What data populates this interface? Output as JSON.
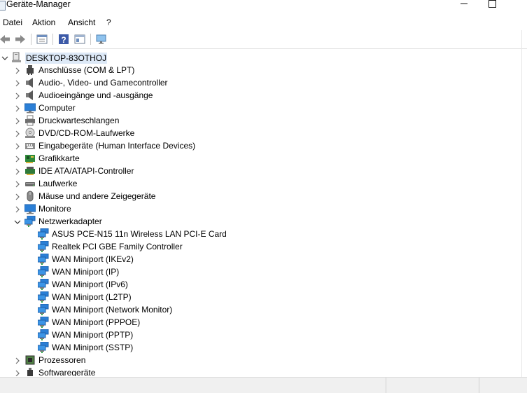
{
  "window": {
    "title": "Geräte-Manager"
  },
  "menu": [
    "Datei",
    "Aktion",
    "Ansicht",
    "?"
  ],
  "toolbar": {
    "buttons": [
      "back-icon",
      "forward-icon",
      "properties-icon",
      "help-icon",
      "view-icon",
      "scan-hardware-icon"
    ]
  },
  "tree": {
    "root": "DESKTOP-83OTHOJ",
    "categories": [
      {
        "label": "Anschlüsse (COM & LPT)",
        "icon": "port-icon"
      },
      {
        "label": "Audio-, Video- und Gamecontroller",
        "icon": "speaker-icon"
      },
      {
        "label": "Audioeingänge und -ausgänge",
        "icon": "speaker-icon"
      },
      {
        "label": "Computer",
        "icon": "monitor-icon"
      },
      {
        "label": "Druckwarteschlangen",
        "icon": "printer-icon"
      },
      {
        "label": "DVD/CD-ROM-Laufwerke",
        "icon": "disc-icon"
      },
      {
        "label": "Eingabegeräte (Human Interface Devices)",
        "icon": "hid-icon"
      },
      {
        "label": "Grafikkarte",
        "icon": "display-adapter-icon"
      },
      {
        "label": "IDE ATA/ATAPI-Controller",
        "icon": "ide-icon"
      },
      {
        "label": "Laufwerke",
        "icon": "drive-icon"
      },
      {
        "label": "Mäuse und andere Zeigegeräte",
        "icon": "mouse-icon"
      },
      {
        "label": "Monitore",
        "icon": "monitor-icon"
      },
      {
        "label": "Netzwerkadapter",
        "icon": "network-icon",
        "expanded": true
      }
    ],
    "network_adapters": [
      "ASUS PCE-N15 11n Wireless LAN PCI-E Card",
      "Realtek PCI GBE Family Controller",
      "WAN Miniport (IKEv2)",
      "WAN Miniport (IP)",
      "WAN Miniport (IPv6)",
      "WAN Miniport (L2TP)",
      "WAN Miniport (Network Monitor)",
      "WAN Miniport (PPPOE)",
      "WAN Miniport (PPTP)",
      "WAN Miniport (SSTP)"
    ],
    "after": [
      {
        "label": "Prozessoren",
        "icon": "processor-icon"
      },
      {
        "label": "Softwaregeräte",
        "icon": "software-device-icon"
      }
    ]
  },
  "colors": {
    "selection": "#dde9f7",
    "monitor_blue": "#2b7fd6",
    "chevron": "#6d6d6d"
  }
}
